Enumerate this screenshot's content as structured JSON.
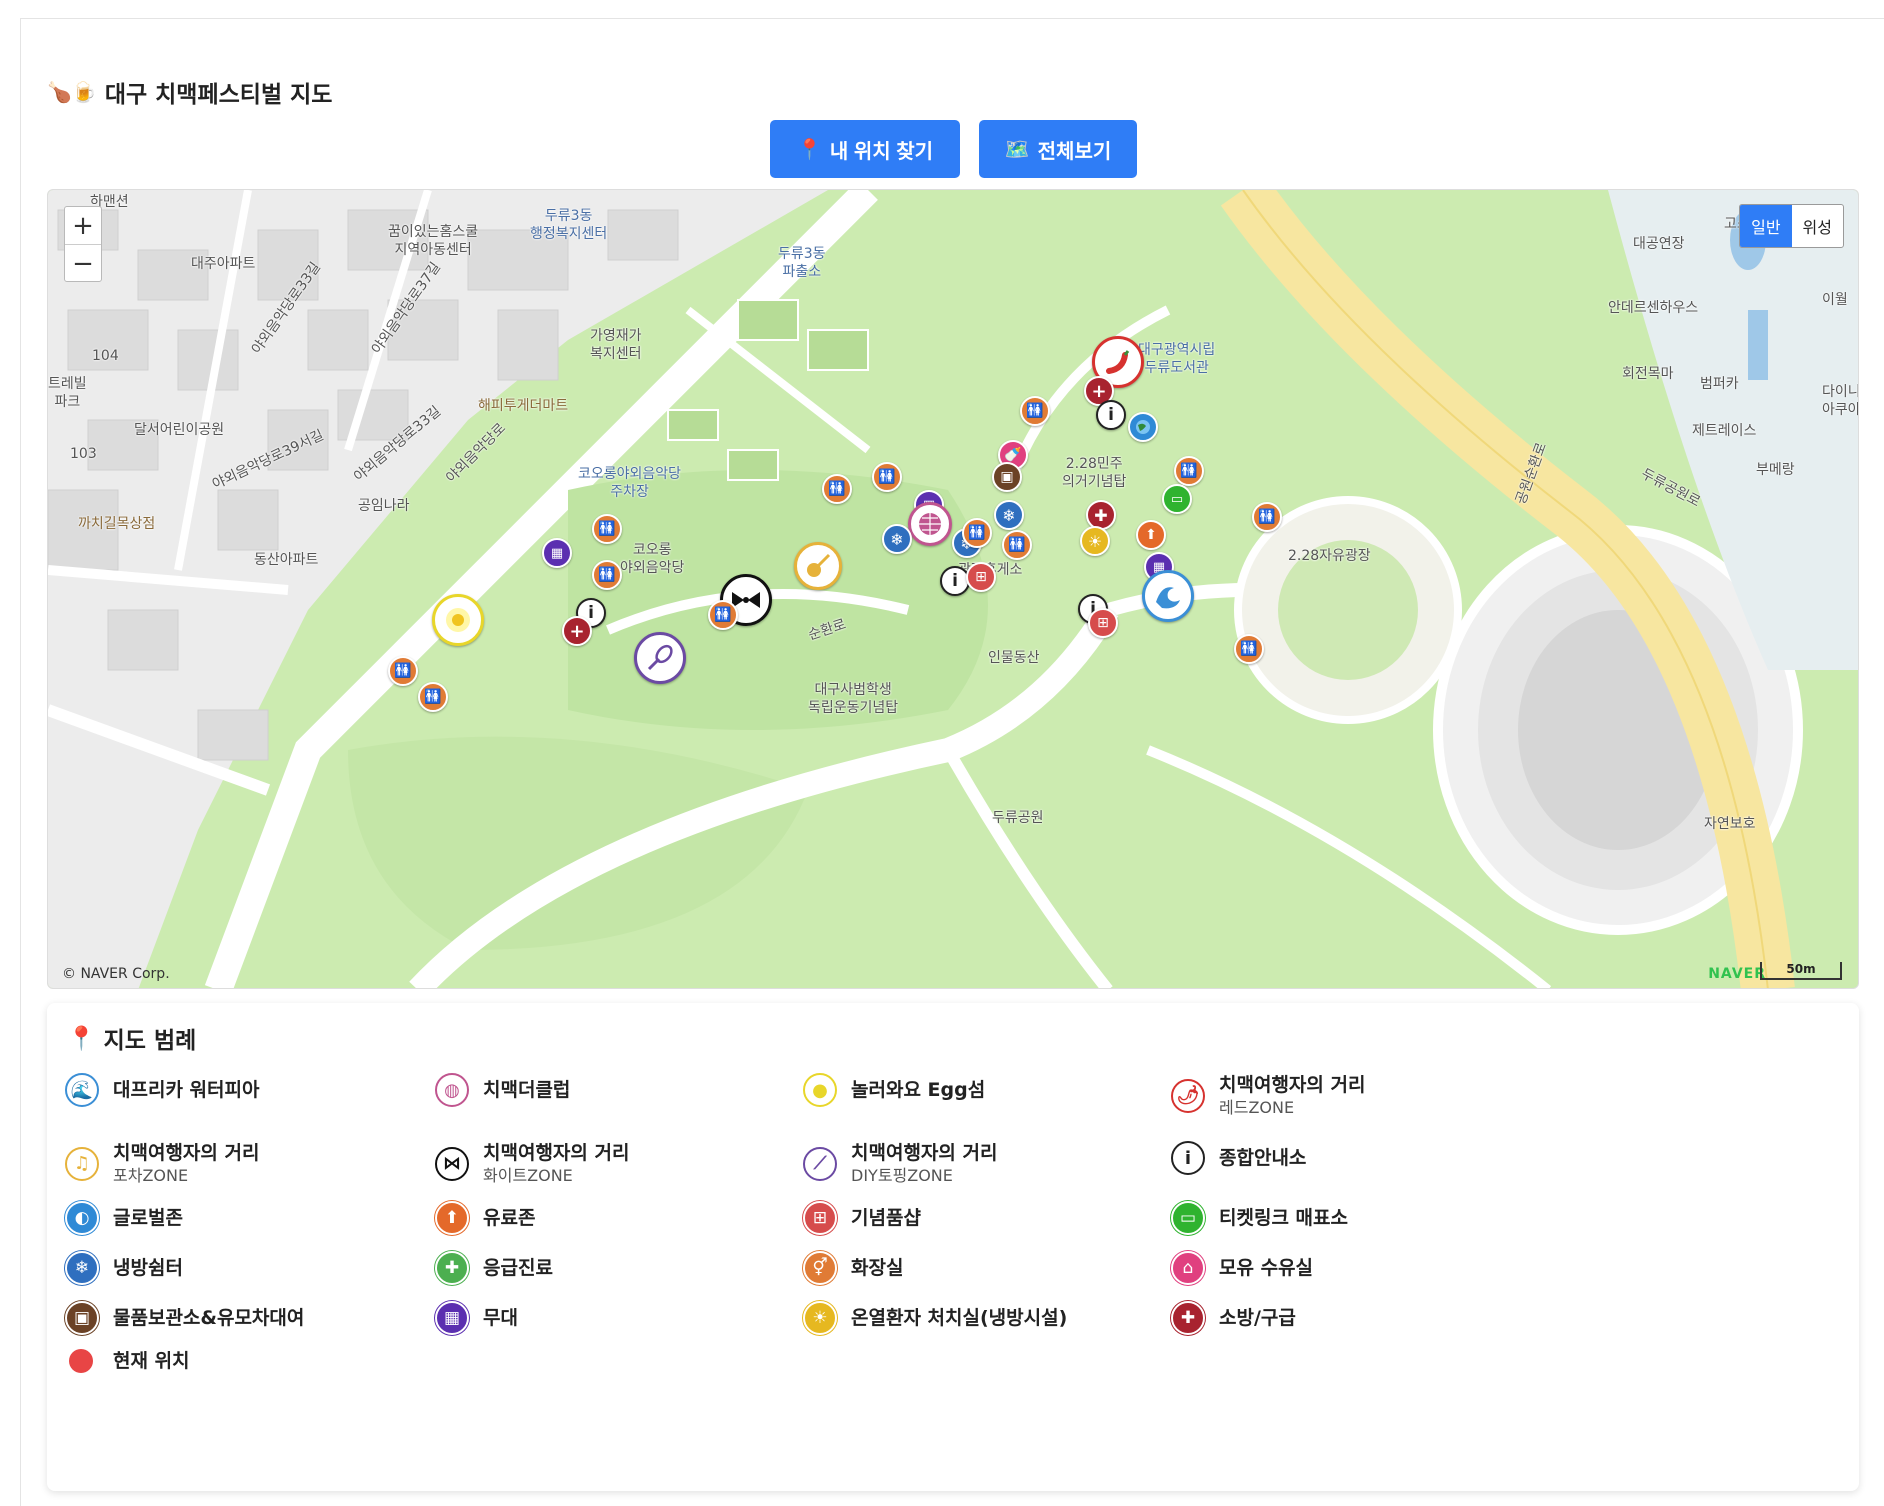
{
  "page": {
    "title_emoji": "🍗🍺",
    "title": "대구 치맥페스티벌 지도"
  },
  "buttons": {
    "my_location_icon": "📍",
    "my_location": "내 위치 찾기",
    "view_all_icon": "🗺️",
    "view_all": "전체보기"
  },
  "map": {
    "zoom_in": "+",
    "zoom_out": "−",
    "type_normal": "일반",
    "type_satellite": "위성",
    "copyright": "© NAVER Corp.",
    "brand": "NAVER",
    "scale": "50m",
    "labels": {
      "hamansin": "하맨션",
      "home_school": "꿈이있는홈스쿨\n지역아동센터",
      "duryu3_admin": "두류3동\n행정복지센터",
      "daeju_apt": "대주아파트",
      "duryu3_police": "두류3동\n파출소",
      "road_33": "야외음악당로33길",
      "road_37": "야외음악당로37길",
      "gayoung": "가영재가\n복지센터",
      "library": "대구광역시립\n두류도서관",
      "daegong": "대공연장",
      "anderson": "안데르센하우스",
      "hwejeon": "회전목마",
      "bumper": "범퍼카",
      "jet": "제트레이스",
      "boomerang": "부메랑",
      "duryu_park_ro": "두류공원로",
      "park_square_ro": "공원순환로",
      "happy_mart": "해피투게더마트",
      "dalseo_park": "달서어린이공원",
      "road_39": "야외음악당로39서길",
      "road_33b": "야외음악당로33길",
      "outdoor_ro": "야외음악당로",
      "gongim": "공임나라",
      "kolon_parking": "코오롱야외음악당\n주차장",
      "kolon_hall": "코오롱\n야외음악당",
      "memorial_228": "2.28민주\n의거기념탑",
      "square_228": "2.28자유광장",
      "rest_area": "광장휴게소",
      "kkachi": "까치길목상점",
      "dongsan_apt": "동산아파트",
      "inmul": "인물동산",
      "teachers": "대구사범학생\n독립운동기념탑",
      "duryu_park": "두류공원",
      "nature": "자연보호",
      "e_world": "이월",
      "dinie": "다이니\n아쿠아",
      "num_104": "104",
      "num_103": "103",
      "terrell": "트레빌\n파크",
      "go": "고스",
      "seunhwan": "순환로"
    }
  },
  "legend": {
    "icon": "📍",
    "title": "지도 범례",
    "items": [
      {
        "name": "대프리카 워터피아",
        "sub": "",
        "icon": "water-icon",
        "color": "#3b8fd6"
      },
      {
        "name": "치맥더클럽",
        "sub": "",
        "icon": "disco-ball-icon",
        "color": "#c0558f"
      },
      {
        "name": "놀러와요 Egg섬",
        "sub": "",
        "icon": "egg-icon",
        "color": "#e8d62a"
      },
      {
        "name": "치맥여행자의 거리",
        "sub": "레드ZONE",
        "icon": "chili-icon",
        "color": "#d6322f"
      },
      {
        "name": "치맥여행자의 거리",
        "sub": "포차ZONE",
        "icon": "guitar-icon",
        "color": "#e6b23a"
      },
      {
        "name": "치맥여행자의 거리",
        "sub": "화이트ZONE",
        "icon": "bowtie-icon",
        "color": "#111111"
      },
      {
        "name": "치맥여행자의 거리",
        "sub": "DIY토핑ZONE",
        "icon": "whisk-icon",
        "color": "#6b4aa3"
      },
      {
        "name": "종합안내소",
        "sub": "",
        "icon": "info-icon",
        "color": "#222222"
      },
      {
        "name": "글로벌존",
        "sub": "",
        "icon": "globe-icon",
        "color": "#2f8ad6"
      },
      {
        "name": "유료존",
        "sub": "",
        "icon": "paid-zone-icon",
        "color": "#e4692a"
      },
      {
        "name": "기념품샵",
        "sub": "",
        "icon": "gift-icon",
        "color": "#d64c4c"
      },
      {
        "name": "티켓링크 매표소",
        "sub": "",
        "icon": "ticket-icon",
        "color": "#2fb32f"
      },
      {
        "name": "냉방쉼터",
        "sub": "",
        "icon": "snowflake-icon",
        "color": "#2f6fbf"
      },
      {
        "name": "응급진료",
        "sub": "",
        "icon": "heart-plus-icon",
        "color": "#4caf50"
      },
      {
        "name": "화장실",
        "sub": "",
        "icon": "restroom-icon",
        "color": "#e07b35"
      },
      {
        "name": "모유 수유실",
        "sub": "",
        "icon": "baby-bottle-icon",
        "color": "#e0407f"
      },
      {
        "name": "물품보관소&유모차대여",
        "sub": "",
        "icon": "locker-icon",
        "color": "#6b4226"
      },
      {
        "name": "무대",
        "sub": "",
        "icon": "stage-icon",
        "color": "#5b2fb0"
      },
      {
        "name": "온열환자 처치실(냉방시설)",
        "sub": "",
        "icon": "sun-icon",
        "color": "#e6b820"
      },
      {
        "name": "소방/구급",
        "sub": "",
        "icon": "fire-aid-icon",
        "color": "#a8232f"
      },
      {
        "name": "현재 위치",
        "sub": "",
        "icon": "current-location-icon",
        "color": "#e84545"
      }
    ]
  }
}
